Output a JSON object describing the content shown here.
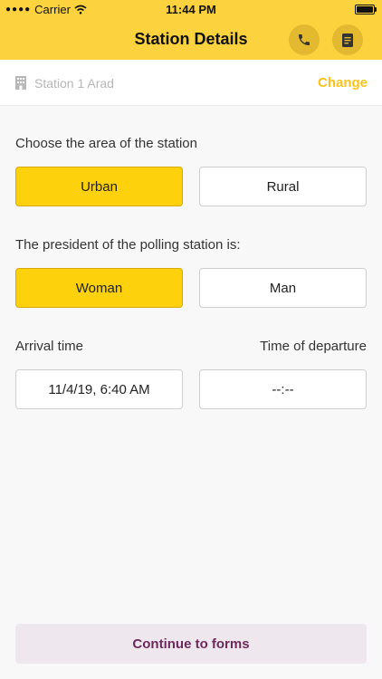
{
  "status_bar": {
    "carrier": "Carrier",
    "time": "11:44 PM"
  },
  "header": {
    "title": "Station Details",
    "phone_icon": "phone-icon",
    "notes_icon": "notes-icon",
    "accent": "#fcd33f"
  },
  "station": {
    "name": "Station 1 Arad",
    "change_label": "Change",
    "icon": "building-icon"
  },
  "area": {
    "question": "Choose the area of the station",
    "options": [
      "Urban",
      "Rural"
    ],
    "selected": "Urban"
  },
  "president": {
    "question": "The president of the polling station is:",
    "options": [
      "Woman",
      "Man"
    ],
    "selected": "Woman"
  },
  "times": {
    "arrival_label": "Arrival time",
    "departure_label": "Time of departure",
    "arrival_value": "11/4/19, 6:40 AM",
    "departure_value": "--:--"
  },
  "footer": {
    "continue_label": "Continue to forms"
  }
}
